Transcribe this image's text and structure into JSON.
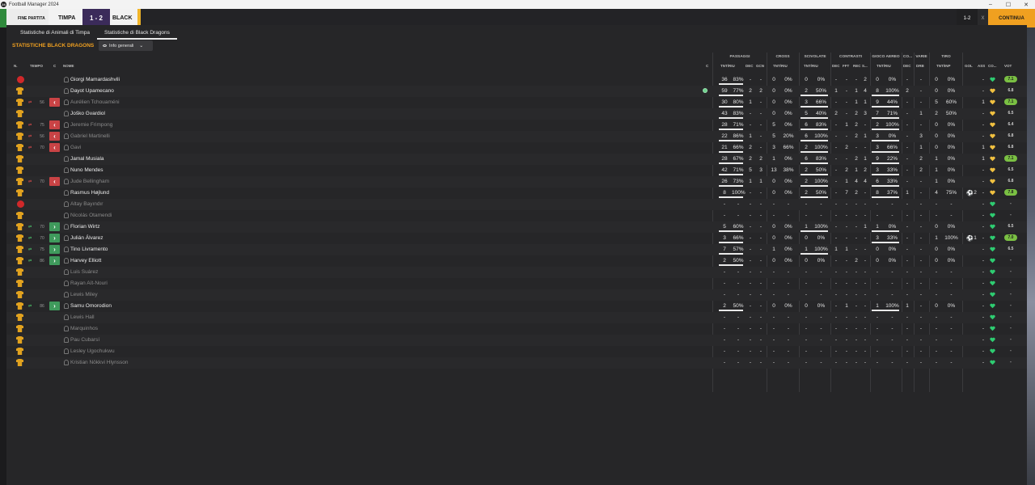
{
  "window": {
    "app_icon": "24",
    "title": "Football Manager 2024",
    "controls": [
      "–",
      "☐",
      "✕"
    ]
  },
  "matchbar": {
    "end_label": "FINE PARTITA",
    "home_team": "TIMPA",
    "score": "1 - 2",
    "away_team": "BLACK",
    "right_score": "1-2",
    "right_x": "X",
    "continue_label": "CONTINUA"
  },
  "tabs": [
    {
      "label": "Statistiche di Animali di Timpa",
      "active": false
    },
    {
      "label": "Statistiche di Black Dragons",
      "active": true
    }
  ],
  "section_title": "STATISTICHE BLACK DRAGONS",
  "view_select": {
    "label": "Info generali"
  },
  "groups": [
    "PASSAGGI",
    "CROSS",
    "SCIVOLATE",
    "CONTRASTI",
    "GIOCO AEREO",
    "CO...",
    "VARIE",
    "TIRO"
  ],
  "columns": {
    "n": "N.",
    "tempo": "TEMPO",
    "c": "C",
    "nome": "NOME",
    "c2": "C",
    "pass_tnt": "TNT/RIU",
    "pass_dec": "DEC",
    "pass_gcn": "GCN",
    "cross_tnt": "TNT/RIU",
    "sciv_tnt": "TNT/RIU",
    "con_dec": "DEC",
    "con_fft": "FFT",
    "con_rec": "REC",
    "con_s": "S...",
    "aereo_tnt": "TNT/RIU",
    "co_dec": "DEC",
    "varie_drb": "DRB",
    "tiro_tnt": "TNT/INP",
    "gol": "GOL",
    "ass": "ASS",
    "co": "CO...",
    "vot": "VOT"
  },
  "players": [
    {
      "name": "Giorgi Mamardashvili",
      "dim": false,
      "kit": "red",
      "sub": "",
      "min": "",
      "p": [
        "36",
        "83%"
      ],
      "pd": "-",
      "pg": "-",
      "cr": [
        "0",
        "0%"
      ],
      "sc": [
        "0",
        "0%"
      ],
      "ct": [
        "-",
        "-",
        "-",
        "2"
      ],
      "ae": [
        "0",
        "0%"
      ],
      "cod": "-",
      "drb": "-",
      "ti": [
        "0",
        "0%"
      ],
      "gol": "",
      "ass": "-",
      "heart": "green",
      "vot": "7.1",
      "votbadge": true
    },
    {
      "name": "Dayot Upamecano",
      "dim": false,
      "kit": "shirt",
      "sub": "",
      "min": "",
      "p": [
        "59",
        "77%"
      ],
      "pd": "2",
      "pg": "2",
      "cr": [
        "0",
        "0%"
      ],
      "sc": [
        "2",
        "50%"
      ],
      "ct": [
        "1",
        "-",
        "1",
        "4"
      ],
      "ae": [
        "8",
        "100%"
      ],
      "cod": "2",
      "drb": "-",
      "ti": [
        "0",
        "0%"
      ],
      "gol": "",
      "ass": "-",
      "heart": "yellow",
      "vot": "6.8",
      "votbadge": false,
      "ball": true
    },
    {
      "name": "Aurélien Tchouaméni",
      "dim": true,
      "kit": "shirt",
      "sub": "out",
      "min": "56",
      "p": [
        "30",
        "80%"
      ],
      "pd": "1",
      "pg": "-",
      "cr": [
        "0",
        "0%"
      ],
      "sc": [
        "3",
        "66%"
      ],
      "ct": [
        "-",
        "-",
        "1",
        "1"
      ],
      "ae": [
        "9",
        "44%"
      ],
      "cod": "-",
      "drb": "-",
      "ti": [
        "5",
        "60%"
      ],
      "gol": "",
      "ass": "1",
      "heart": "yellow",
      "vot": "7.1",
      "votbadge": true
    },
    {
      "name": "Joško Gvardiol",
      "dim": false,
      "kit": "shirt",
      "sub": "",
      "min": "",
      "p": [
        "43",
        "83%"
      ],
      "pd": "-",
      "pg": "-",
      "cr": [
        "0",
        "0%"
      ],
      "sc": [
        "5",
        "40%"
      ],
      "ct": [
        "2",
        "-",
        "2",
        "3"
      ],
      "ae": [
        "7",
        "71%"
      ],
      "cod": "-",
      "drb": "1",
      "ti": [
        "2",
        "50%"
      ],
      "gol": "",
      "ass": "-",
      "heart": "yellow",
      "vot": "6.5",
      "votbadge": false
    },
    {
      "name": "Jeremie Frimpong",
      "dim": true,
      "kit": "shirt",
      "sub": "out",
      "min": "75",
      "p": [
        "28",
        "71%"
      ],
      "pd": "-",
      "pg": "-",
      "cr": [
        "5",
        "0%"
      ],
      "sc": [
        "6",
        "83%"
      ],
      "ct": [
        "-",
        "1",
        "2",
        "-"
      ],
      "ae": [
        "2",
        "100%"
      ],
      "cod": "-",
      "drb": "-",
      "ti": [
        "0",
        "0%"
      ],
      "gol": "",
      "ass": "-",
      "heart": "yellow",
      "vot": "6.4",
      "votbadge": false
    },
    {
      "name": "Gabriel Martinelli",
      "dim": true,
      "kit": "shirt",
      "sub": "out",
      "min": "56",
      "p": [
        "22",
        "86%"
      ],
      "pd": "1",
      "pg": "-",
      "cr": [
        "5",
        "20%"
      ],
      "sc": [
        "6",
        "100%"
      ],
      "ct": [
        "-",
        "-",
        "2",
        "1"
      ],
      "ae": [
        "3",
        "0%"
      ],
      "cod": "-",
      "drb": "3",
      "ti": [
        "0",
        "0%"
      ],
      "gol": "",
      "ass": "-",
      "heart": "yellow",
      "vot": "6.8",
      "votbadge": false
    },
    {
      "name": "Gavi",
      "dim": true,
      "kit": "shirt",
      "sub": "out",
      "min": "70",
      "p": [
        "21",
        "66%"
      ],
      "pd": "2",
      "pg": "-",
      "cr": [
        "3",
        "66%"
      ],
      "sc": [
        "2",
        "100%"
      ],
      "ct": [
        "-",
        "2",
        "-",
        "-"
      ],
      "ae": [
        "3",
        "66%"
      ],
      "cod": "-",
      "drb": "1",
      "ti": [
        "0",
        "0%"
      ],
      "gol": "",
      "ass": "1",
      "heart": "yellow",
      "vot": "6.8",
      "votbadge": false
    },
    {
      "name": "Jamal Musiala",
      "dim": false,
      "kit": "shirt",
      "sub": "",
      "min": "",
      "p": [
        "28",
        "67%"
      ],
      "pd": "2",
      "pg": "2",
      "cr": [
        "1",
        "0%"
      ],
      "sc": [
        "6",
        "83%"
      ],
      "ct": [
        "-",
        "-",
        "2",
        "1"
      ],
      "ae": [
        "9",
        "22%"
      ],
      "cod": "-",
      "drb": "2",
      "ti": [
        "1",
        "0%"
      ],
      "gol": "",
      "ass": "1",
      "heart": "yellow",
      "vot": "7.1",
      "votbadge": true
    },
    {
      "name": "Nuno Mendes",
      "dim": false,
      "kit": "shirt",
      "sub": "",
      "min": "",
      "p": [
        "42",
        "71%"
      ],
      "pd": "5",
      "pg": "3",
      "cr": [
        "13",
        "38%"
      ],
      "sc": [
        "2",
        "50%"
      ],
      "ct": [
        "-",
        "2",
        "1",
        "2"
      ],
      "ae": [
        "3",
        "33%"
      ],
      "cod": "-",
      "drb": "2",
      "ti": [
        "1",
        "0%"
      ],
      "gol": "",
      "ass": "-",
      "heart": "yellow",
      "vot": "6.5",
      "votbadge": false
    },
    {
      "name": "Jude Bellingham",
      "dim": true,
      "kit": "shirt",
      "sub": "out",
      "min": "70",
      "p": [
        "26",
        "73%"
      ],
      "pd": "1",
      "pg": "1",
      "cr": [
        "0",
        "0%"
      ],
      "sc": [
        "2",
        "100%"
      ],
      "ct": [
        "-",
        "1",
        "4",
        "4"
      ],
      "ae": [
        "6",
        "33%"
      ],
      "cod": "-",
      "drb": "-",
      "ti": [
        "1",
        "0%"
      ],
      "gol": "",
      "ass": "-",
      "heart": "yellow",
      "vot": "6.8",
      "votbadge": false
    },
    {
      "name": "Rasmus Højlund",
      "dim": false,
      "kit": "shirt",
      "sub": "",
      "min": "",
      "p": [
        "8",
        "100%"
      ],
      "pd": "-",
      "pg": "-",
      "cr": [
        "0",
        "0%"
      ],
      "sc": [
        "2",
        "50%"
      ],
      "ct": [
        "-",
        "7",
        "2",
        "-"
      ],
      "ae": [
        "8",
        "37%"
      ],
      "cod": "1",
      "drb": "-",
      "ti": [
        "4",
        "75%"
      ],
      "gol": "2",
      "ass": "-",
      "heart": "yellow",
      "vot": "7.8",
      "votbadge": true
    },
    {
      "name": "Altay Bayındır",
      "dim": true,
      "kit": "red",
      "sub": "",
      "min": "",
      "p": [
        "-",
        "-"
      ],
      "pd": "-",
      "pg": "-",
      "cr": [
        "-",
        "-"
      ],
      "sc": [
        "-",
        "-"
      ],
      "ct": [
        "-",
        "-",
        "-",
        "-"
      ],
      "ae": [
        "-",
        "-"
      ],
      "cod": "-",
      "drb": "-",
      "ti": [
        "-",
        "-"
      ],
      "gol": "",
      "ass": "-",
      "heart": "green",
      "vot": "-",
      "votbadge": false
    },
    {
      "name": "Nicolás Otamendi",
      "dim": true,
      "kit": "shirt",
      "sub": "",
      "min": "",
      "p": [
        "-",
        "-"
      ],
      "pd": "-",
      "pg": "-",
      "cr": [
        "-",
        "-"
      ],
      "sc": [
        "-",
        "-"
      ],
      "ct": [
        "-",
        "-",
        "-",
        "-"
      ],
      "ae": [
        "-",
        "-"
      ],
      "cod": "-",
      "drb": "-",
      "ti": [
        "-",
        "-"
      ],
      "gol": "",
      "ass": "-",
      "heart": "green",
      "vot": "-",
      "votbadge": false
    },
    {
      "name": "Florian Wirtz",
      "dim": false,
      "kit": "shirt",
      "sub": "in",
      "min": "70",
      "p": [
        "5",
        "60%"
      ],
      "pd": "-",
      "pg": "-",
      "cr": [
        "0",
        "0%"
      ],
      "sc": [
        "1",
        "100%"
      ],
      "ct": [
        "-",
        "-",
        "-",
        "1"
      ],
      "ae": [
        "1",
        "0%"
      ],
      "cod": "-",
      "drb": "-",
      "ti": [
        "0",
        "0%"
      ],
      "gol": "",
      "ass": "-",
      "heart": "green",
      "vot": "6.5",
      "votbadge": false
    },
    {
      "name": "Julián Álvarez",
      "dim": false,
      "kit": "shirt",
      "sub": "in",
      "min": "70",
      "p": [
        "3",
        "66%"
      ],
      "pd": "-",
      "pg": "-",
      "cr": [
        "0",
        "0%"
      ],
      "sc": [
        "0",
        "0%"
      ],
      "ct": [
        "-",
        "-",
        "-",
        "-"
      ],
      "ae": [
        "3",
        "33%"
      ],
      "cod": "-",
      "drb": "-",
      "ti": [
        "1",
        "100%"
      ],
      "gol": "1",
      "ass": "-",
      "heart": "green",
      "vot": "7.0",
      "votbadge": true
    },
    {
      "name": "Tino Livramento",
      "dim": false,
      "kit": "shirt",
      "sub": "in",
      "min": "75",
      "p": [
        "7",
        "57%"
      ],
      "pd": "-",
      "pg": "-",
      "cr": [
        "1",
        "0%"
      ],
      "sc": [
        "1",
        "100%"
      ],
      "ct": [
        "1",
        "1",
        "-",
        "-"
      ],
      "ae": [
        "0",
        "0%"
      ],
      "cod": "-",
      "drb": "-",
      "ti": [
        "0",
        "0%"
      ],
      "gol": "",
      "ass": "-",
      "heart": "green",
      "vot": "6.5",
      "votbadge": false
    },
    {
      "name": "Harvey Elliott",
      "dim": false,
      "kit": "shirt",
      "sub": "in",
      "min": "86",
      "p": [
        "2",
        "50%"
      ],
      "pd": "-",
      "pg": "-",
      "cr": [
        "0",
        "0%"
      ],
      "sc": [
        "0",
        "0%"
      ],
      "ct": [
        "-",
        "-",
        "2",
        "-"
      ],
      "ae": [
        "0",
        "0%"
      ],
      "cod": "-",
      "drb": "-",
      "ti": [
        "0",
        "0%"
      ],
      "gol": "",
      "ass": "-",
      "heart": "green",
      "vot": "-",
      "votbadge": false
    },
    {
      "name": "Luis Suárez",
      "dim": true,
      "kit": "shirt",
      "sub": "",
      "min": "",
      "p": [
        "-",
        "-"
      ],
      "pd": "-",
      "pg": "-",
      "cr": [
        "-",
        "-"
      ],
      "sc": [
        "-",
        "-"
      ],
      "ct": [
        "-",
        "-",
        "-",
        "-"
      ],
      "ae": [
        "-",
        "-"
      ],
      "cod": "-",
      "drb": "-",
      "ti": [
        "-",
        "-"
      ],
      "gol": "",
      "ass": "-",
      "heart": "green",
      "vot": "-",
      "votbadge": false
    },
    {
      "name": "Rayan Aït-Nouri",
      "dim": true,
      "kit": "shirt",
      "sub": "",
      "min": "",
      "p": [
        "-",
        "-"
      ],
      "pd": "-",
      "pg": "-",
      "cr": [
        "-",
        "-"
      ],
      "sc": [
        "-",
        "-"
      ],
      "ct": [
        "-",
        "-",
        "-",
        "-"
      ],
      "ae": [
        "-",
        "-"
      ],
      "cod": "-",
      "drb": "-",
      "ti": [
        "-",
        "-"
      ],
      "gol": "",
      "ass": "-",
      "heart": "green",
      "vot": "-",
      "votbadge": false
    },
    {
      "name": "Lewis Miley",
      "dim": true,
      "kit": "shirt",
      "sub": "",
      "min": "",
      "p": [
        "-",
        "-"
      ],
      "pd": "-",
      "pg": "-",
      "cr": [
        "-",
        "-"
      ],
      "sc": [
        "-",
        "-"
      ],
      "ct": [
        "-",
        "-",
        "-",
        "-"
      ],
      "ae": [
        "-",
        "-"
      ],
      "cod": "-",
      "drb": "-",
      "ti": [
        "-",
        "-"
      ],
      "gol": "",
      "ass": "-",
      "heart": "green",
      "vot": "-",
      "votbadge": false
    },
    {
      "name": "Samu Omorodion",
      "dim": false,
      "kit": "shirt",
      "sub": "in",
      "min": "86",
      "p": [
        "2",
        "50%"
      ],
      "pd": "-",
      "pg": "-",
      "cr": [
        "0",
        "0%"
      ],
      "sc": [
        "0",
        "0%"
      ],
      "ct": [
        "-",
        "1",
        "-",
        "-"
      ],
      "ae": [
        "1",
        "100%"
      ],
      "cod": "1",
      "drb": "-",
      "ti": [
        "0",
        "0%"
      ],
      "gol": "",
      "ass": "-",
      "heart": "green",
      "vot": "-",
      "votbadge": false
    },
    {
      "name": "Lewis Hall",
      "dim": true,
      "kit": "shirt",
      "sub": "",
      "min": "",
      "p": [
        "-",
        "-"
      ],
      "pd": "-",
      "pg": "-",
      "cr": [
        "-",
        "-"
      ],
      "sc": [
        "-",
        "-"
      ],
      "ct": [
        "-",
        "-",
        "-",
        "-"
      ],
      "ae": [
        "-",
        "-"
      ],
      "cod": "-",
      "drb": "-",
      "ti": [
        "-",
        "-"
      ],
      "gol": "",
      "ass": "-",
      "heart": "green",
      "vot": "-",
      "votbadge": false
    },
    {
      "name": "Marquinhos",
      "dim": true,
      "kit": "shirt",
      "sub": "",
      "min": "",
      "p": [
        "-",
        "-"
      ],
      "pd": "-",
      "pg": "-",
      "cr": [
        "-",
        "-"
      ],
      "sc": [
        "-",
        "-"
      ],
      "ct": [
        "-",
        "-",
        "-",
        "-"
      ],
      "ae": [
        "-",
        "-"
      ],
      "cod": "-",
      "drb": "-",
      "ti": [
        "-",
        "-"
      ],
      "gol": "",
      "ass": "-",
      "heart": "green",
      "vot": "-",
      "votbadge": false
    },
    {
      "name": "Pau Cubarsí",
      "dim": true,
      "kit": "shirt",
      "sub": "",
      "min": "",
      "p": [
        "-",
        "-"
      ],
      "pd": "-",
      "pg": "-",
      "cr": [
        "-",
        "-"
      ],
      "sc": [
        "-",
        "-"
      ],
      "ct": [
        "-",
        "-",
        "-",
        "-"
      ],
      "ae": [
        "-",
        "-"
      ],
      "cod": "-",
      "drb": "-",
      "ti": [
        "-",
        "-"
      ],
      "gol": "",
      "ass": "-",
      "heart": "green",
      "vot": "-",
      "votbadge": false
    },
    {
      "name": "Lesley Ugochukwu",
      "dim": true,
      "kit": "shirt",
      "sub": "",
      "min": "",
      "p": [
        "-",
        "-"
      ],
      "pd": "-",
      "pg": "-",
      "cr": [
        "-",
        "-"
      ],
      "sc": [
        "-",
        "-"
      ],
      "ct": [
        "-",
        "-",
        "-",
        "-"
      ],
      "ae": [
        "-",
        "-"
      ],
      "cod": "-",
      "drb": "-",
      "ti": [
        "-",
        "-"
      ],
      "gol": "",
      "ass": "-",
      "heart": "green",
      "vot": "-",
      "votbadge": false
    },
    {
      "name": "Kristian Nökkvi Hlynsson",
      "dim": true,
      "kit": "shirt",
      "sub": "",
      "min": "",
      "p": [
        "-",
        "-"
      ],
      "pd": "-",
      "pg": "-",
      "cr": [
        "-",
        "-"
      ],
      "sc": [
        "-",
        "-"
      ],
      "ct": [
        "-",
        "-",
        "-",
        "-"
      ],
      "ae": [
        "-",
        "-"
      ],
      "cod": "-",
      "drb": "-",
      "ti": [
        "-",
        "-"
      ],
      "gol": "",
      "ass": "-",
      "heart": "green",
      "vot": "-",
      "votbadge": false
    }
  ]
}
